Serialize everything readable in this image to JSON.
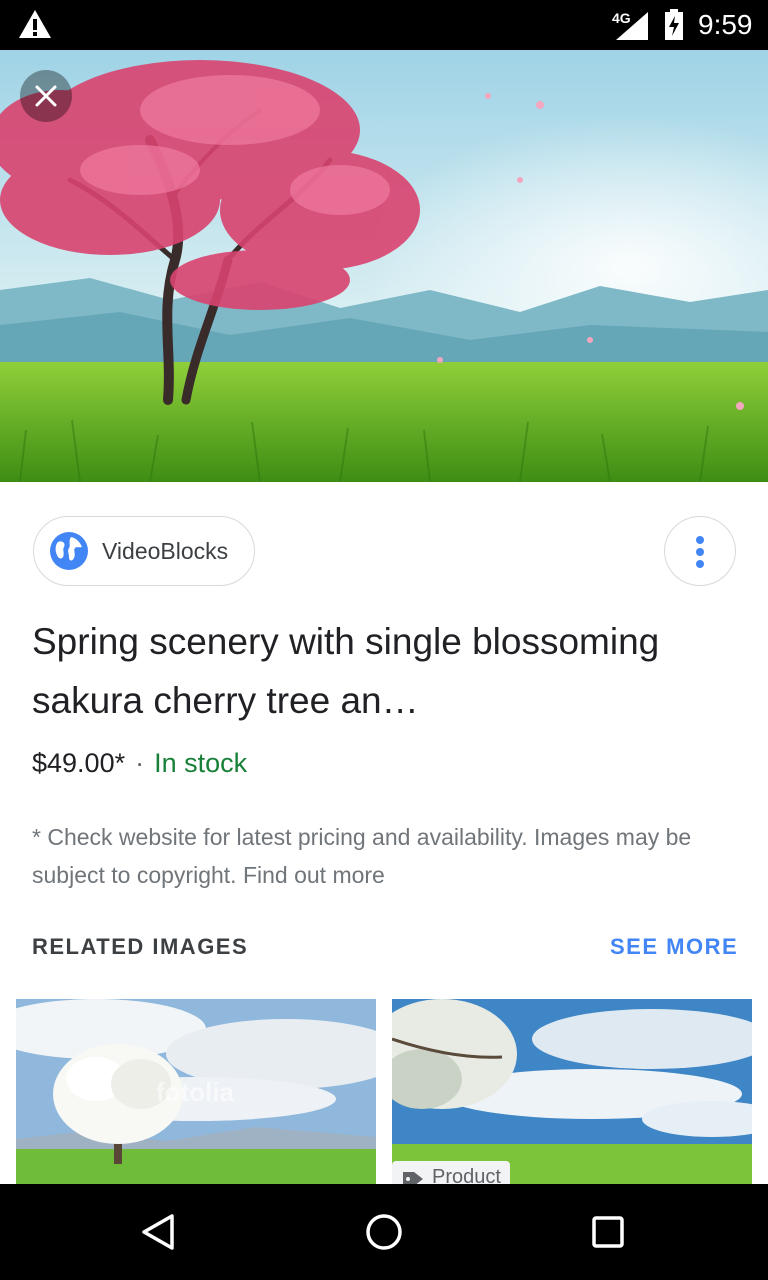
{
  "status_bar": {
    "time": "9:59",
    "network": "4G",
    "icons": [
      "warning-icon",
      "signal-icon",
      "battery-charging-icon"
    ]
  },
  "hero": {
    "icons": [
      "close-icon"
    ]
  },
  "source": {
    "label": "VideoBlocks",
    "icon": "globe-icon"
  },
  "title": "Spring scenery with single blossoming sakura cherry tree an…",
  "price": "$49.00*",
  "separator": "·",
  "stock_status": "In stock",
  "disclaimer": "* Check website for latest pricing and availability. Images may be subject to copyright. Find out more",
  "related": {
    "heading": "RELATED IMAGES",
    "see_more": "SEE MORE",
    "items": [
      {
        "watermark": "fotolia"
      },
      {
        "badge": "Product"
      }
    ]
  },
  "colors": {
    "accent": "#4285f4",
    "stock_green": "#188038",
    "secondary_text": "#70757a"
  },
  "navigation": {
    "icons": [
      "back-icon",
      "home-icon",
      "recents-icon"
    ]
  }
}
